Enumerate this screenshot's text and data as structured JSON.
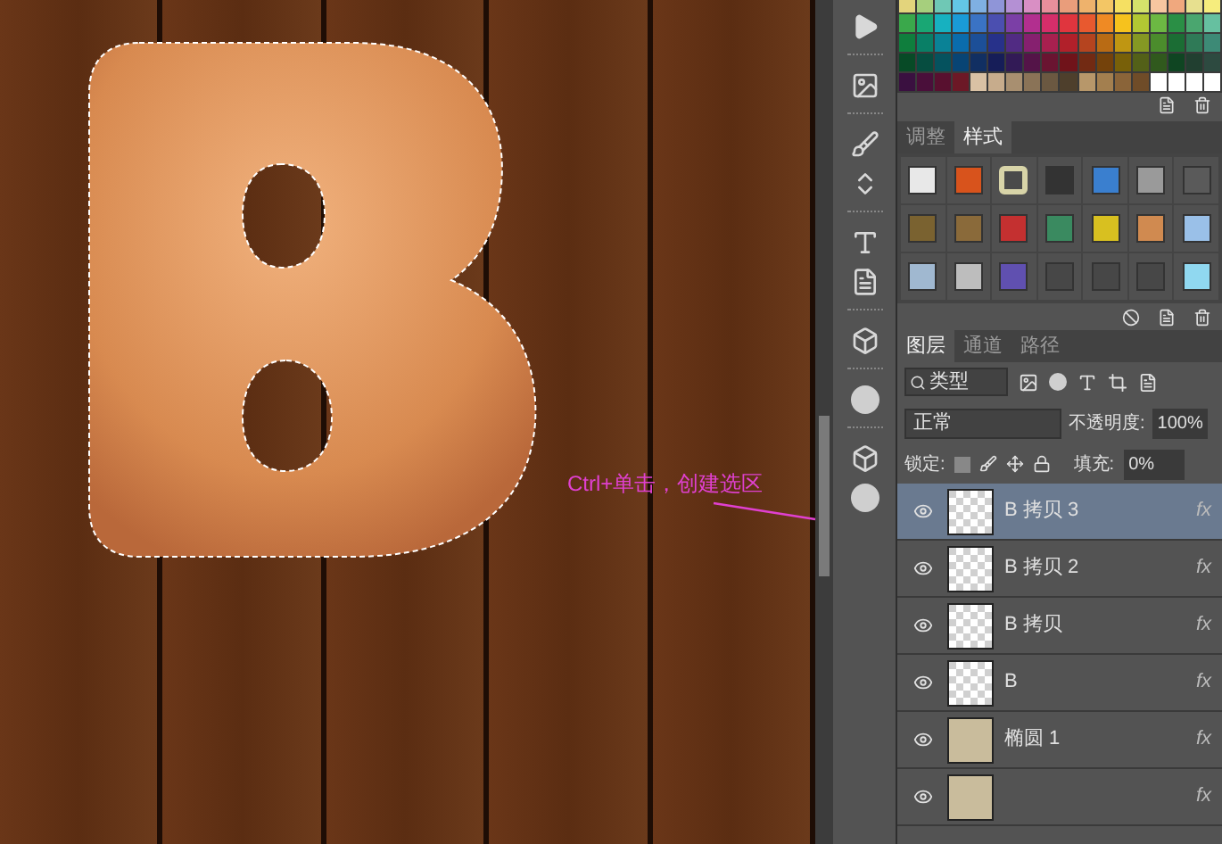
{
  "annotation": {
    "text": "Ctrl+单击，创建选区"
  },
  "styles_panel": {
    "tabs": [
      {
        "label": "调整",
        "selected": false
      },
      {
        "label": "样式",
        "selected": true
      }
    ],
    "styles": [
      {
        "selected": false
      },
      {
        "selected": false
      },
      {
        "selected": true
      },
      {
        "selected": false
      },
      {
        "selected": false
      },
      {
        "selected": false
      },
      {
        "selected": false
      },
      {
        "selected": false
      },
      {
        "selected": false
      },
      {
        "selected": false
      },
      {
        "selected": false
      },
      {
        "selected": false
      },
      {
        "selected": false
      },
      {
        "selected": false
      },
      {
        "selected": false
      },
      {
        "selected": false
      },
      {
        "selected": false
      },
      {
        "selected": false
      },
      {
        "selected": false
      },
      {
        "selected": false
      },
      {
        "selected": false
      }
    ]
  },
  "layers_panel": {
    "tabs": [
      {
        "label": "图层",
        "selected": true
      },
      {
        "label": "通道",
        "selected": false
      },
      {
        "label": "路径",
        "selected": false
      }
    ],
    "filter": "类型",
    "blend_mode": "正常",
    "opacity_label": "不透明度:",
    "opacity": "100%",
    "lock_label": "锁定:",
    "fill_label": "填充:",
    "fill": "0%",
    "layers": [
      {
        "name": "B 拷贝 3",
        "selected": true,
        "visible": true,
        "kind": "transparent",
        "effects": "fx"
      },
      {
        "name": "B 拷贝 2",
        "selected": false,
        "visible": true,
        "kind": "transparent",
        "effects": "fx"
      },
      {
        "name": "B 拷贝",
        "selected": false,
        "visible": true,
        "kind": "transparent",
        "effects": "fx"
      },
      {
        "name": "B",
        "selected": false,
        "visible": true,
        "kind": "transparent",
        "effects": "fx"
      },
      {
        "name": "椭圆 1",
        "selected": false,
        "visible": true,
        "kind": "filled",
        "effects": "fx"
      },
      {
        "selected": false,
        "visible": true,
        "kind": "filled",
        "effects": "fx"
      }
    ]
  }
}
